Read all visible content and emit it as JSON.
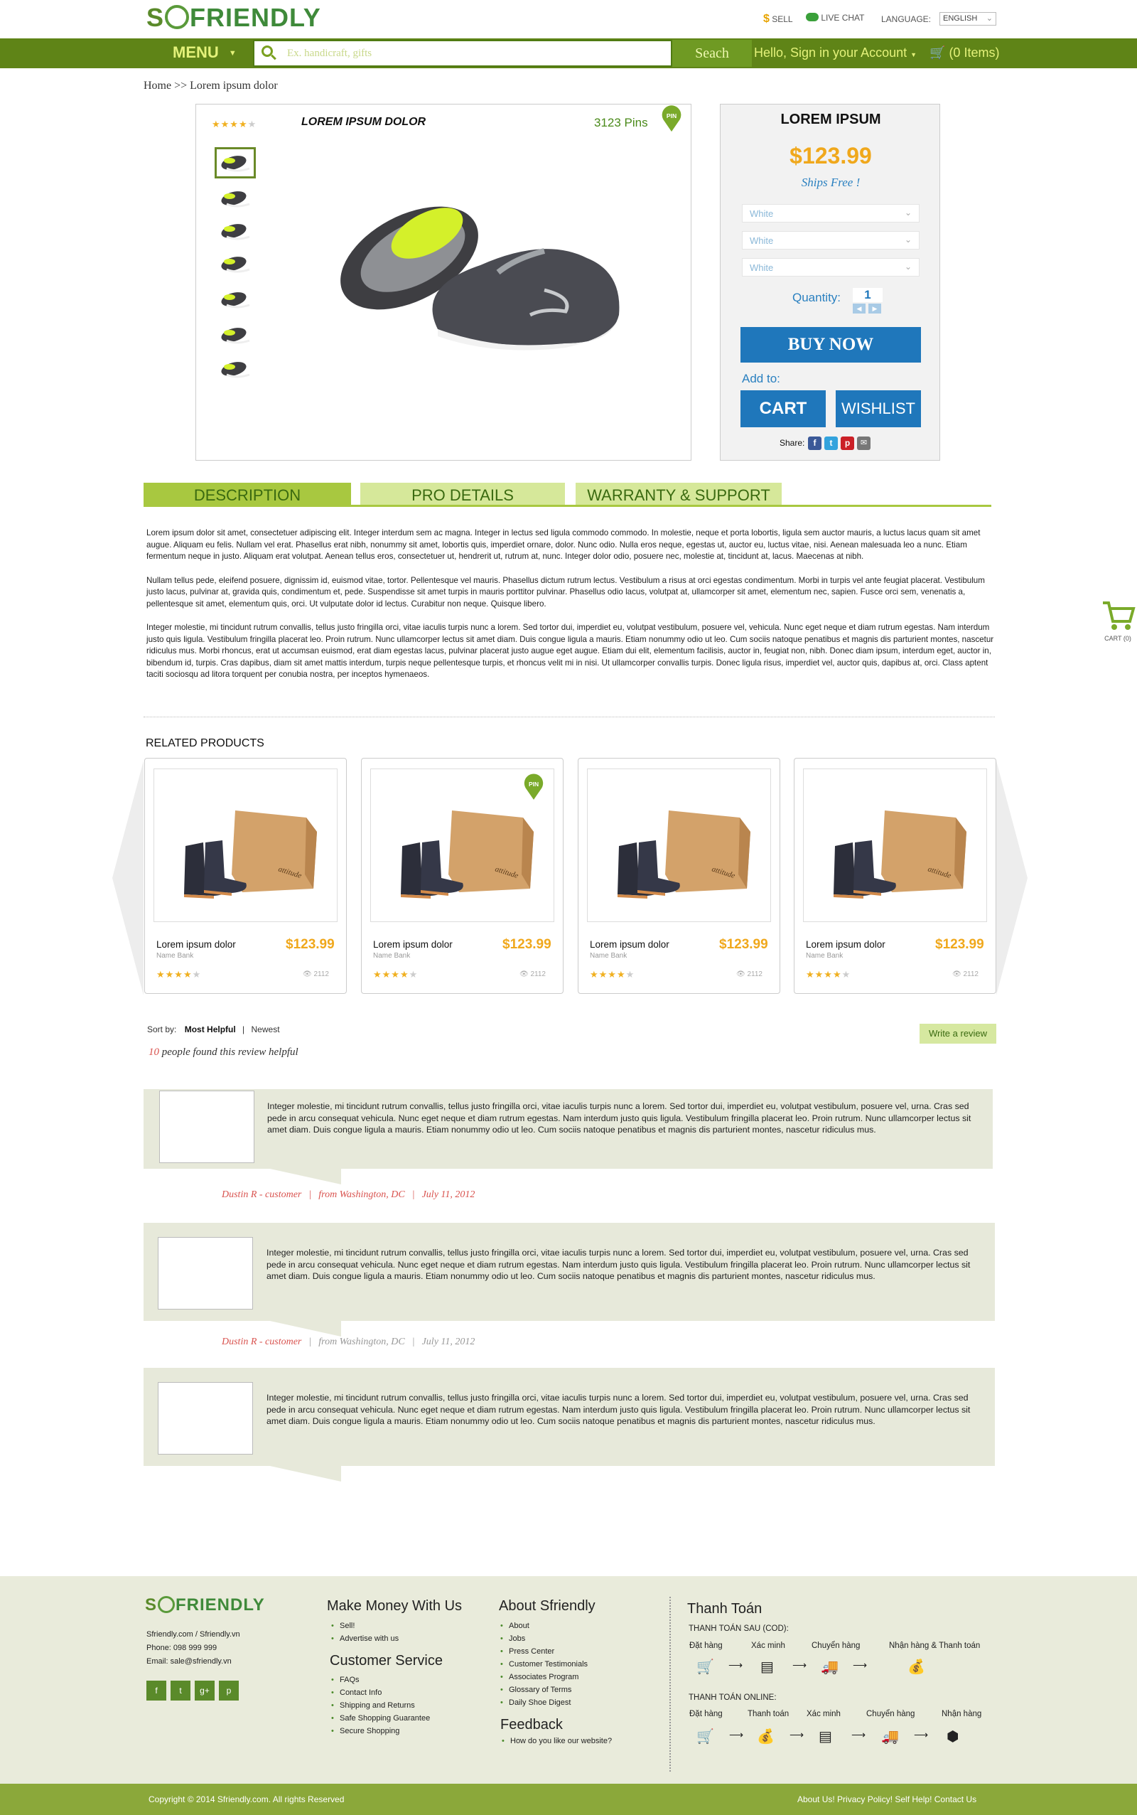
{
  "header": {
    "logo_prefix": "S",
    "logo_suffix": "FRIENDLY",
    "sell": "SELL",
    "live_chat": "LIVE CHAT",
    "language_label": "LANGUAGE:",
    "language_value": "ENGLISH",
    "menu": "MENU",
    "search_placeholder": "Ex. handicraft, gifts",
    "search_button": "Seach",
    "account": "Hello, Sign in your Account",
    "cart_items": "(0 Items)"
  },
  "breadcrumb": "Home >> Lorem ipsum dolor",
  "product": {
    "name": "LOREM IPSUM DOLOR",
    "pins": "3123 Pins",
    "pin_badge": "PIN",
    "rating": 4,
    "thumb_count": 7
  },
  "buy_panel": {
    "title": "LOREM IPSUM",
    "price": "$123.99",
    "shipping": "Ships Free !",
    "options": [
      "White",
      "White",
      "White"
    ],
    "quantity_label": "Quantity:",
    "quantity_value": "1",
    "buy_now": "BUY NOW",
    "add_to": "Add to:",
    "cart": "CART",
    "wishlist": "WISHLIST",
    "share": "Share:"
  },
  "tabs": [
    "DESCRIPTION",
    "PRO DETAILS",
    "WARRANTY & SUPPORT"
  ],
  "description": [
    "Lorem ipsum dolor sit amet, consectetuer adipiscing elit. Integer interdum sem ac magna. Integer in lectus sed ligula commodo commodo. In molestie, neque et porta lobortis, ligula sem auctor mauris, a luctus lacus quam sit amet augue. Aliquam eu felis. Nullam vel erat. Phasellus erat nibh, nonummy sit amet, lobortis quis, imperdiet ornare, dolor. Nunc odio. Nulla eros neque, egestas ut, auctor eu, luctus vitae, nisi. Aenean malesuada leo a nunc. Etiam fermentum neque in justo. Aliquam erat volutpat. Aenean tellus eros, consectetuer ut, hendrerit ut, rutrum at, nunc. Integer dolor odio, posuere nec, molestie at, tincidunt at, lacus. Maecenas at nibh.",
    "Nullam tellus pede, eleifend posuere, dignissim id, euismod vitae, tortor. Pellentesque vel mauris. Phasellus dictum rutrum lectus. Vestibulum a risus at orci egestas condimentum. Morbi in turpis vel ante feugiat placerat. Vestibulum justo lacus, pulvinar at, gravida quis, condimentum et, pede. Suspendisse sit amet turpis in mauris porttitor pulvinar. Phasellus odio lacus, volutpat at, ullamcorper sit amet, elementum nec, sapien. Fusce orci sem, venenatis a, pellentesque sit amet, elementum quis, orci. Ut vulputate dolor id lectus. Curabitur non neque. Quisque libero.",
    "Integer molestie, mi tincidunt rutrum convallis, tellus justo fringilla orci, vitae iaculis turpis nunc a lorem. Sed tortor dui, imperdiet eu, volutpat vestibulum, posuere vel, vehicula. Nunc eget neque et diam rutrum egestas. Nam interdum justo quis ligula. Vestibulum fringilla placerat leo. Proin rutrum. Nunc ullamcorper lectus sit amet diam. Duis congue ligula a mauris. Etiam nonummy odio ut leo. Cum sociis natoque penatibus et magnis dis parturient montes, nascetur ridiculus mus. Morbi rhoncus, erat ut accumsan euismod, erat diam egestas lacus, pulvinar placerat justo augue eget augue. Etiam dui elit, elementum facilisis, auctor in, feugiat non, nibh. Donec diam ipsum, interdum eget, auctor in, bibendum id, turpis. Cras dapibus, diam sit amet mattis interdum, turpis neque pellentesque turpis, et rhoncus velit mi in nisi. Ut ullamcorper convallis turpis. Donec ligula risus, imperdiet vel, auctor quis, dapibus at, orci. Class aptent taciti sociosqu ad litora torquent per conubia nostra, per inceptos hymenaeos."
  ],
  "side_cart": "CART (0)",
  "related": {
    "title": "RELATED PRODUCTS",
    "items": [
      {
        "name": "Lorem ipsum dolor",
        "brand": "Name Bank",
        "price": "$123.99",
        "views": "2112",
        "rating": 4,
        "pin": false
      },
      {
        "name": "Lorem ipsum dolor",
        "brand": "Name Bank",
        "price": "$123.99",
        "views": "2112",
        "rating": 4,
        "pin": true
      },
      {
        "name": "Lorem ipsum dolor",
        "brand": "Name Bank",
        "price": "$123.99",
        "views": "2112",
        "rating": 4,
        "pin": false
      },
      {
        "name": "Lorem ipsum dolor",
        "brand": "Name Bank",
        "price": "$123.99",
        "views": "2112",
        "rating": 4,
        "pin": false
      }
    ],
    "box_label": "attitude"
  },
  "reviews": {
    "sort_label": "Sort by:",
    "sort_most_helpful": "Most Helpful",
    "sort_sep": "|",
    "sort_newest": "Newest",
    "write_review": "Write a review",
    "helpful_count": "10",
    "helpful_text": "people found this review helpful",
    "items": [
      {
        "text": "Integer molestie, mi tincidunt rutrum convallis, tellus justo fringilla orci, vitae iaculis turpis nunc a lorem. Sed tortor dui, imperdiet eu, volutpat vestibulum, posuere vel, urna. Cras sed pede in arcu consequat vehicula. Nunc eget neque et diam rutrum egestas. Nam interdum justo quis ligula. Vestibulum fringilla placerat leo. Proin rutrum. Nunc ullamcorper lectus sit amet diam. Duis congue ligula a mauris. Etiam nonummy odio ut leo. Cum sociis natoque penatibus et magnis dis parturient montes, nascetur ridiculus mus.",
        "author": "Dustin R - customer",
        "location": "from Washington, DC",
        "date": "July 11, 2012"
      },
      {
        "text": "Integer molestie, mi tincidunt rutrum convallis, tellus justo fringilla orci, vitae iaculis turpis nunc a lorem. Sed tortor dui, imperdiet eu, volutpat vestibulum, posuere vel, urna. Cras sed pede in arcu consequat vehicula. Nunc eget neque et diam rutrum egestas. Nam interdum justo quis ligula. Vestibulum fringilla placerat leo. Proin rutrum. Nunc ullamcorper lectus sit amet diam. Duis congue ligula a mauris. Etiam nonummy odio ut leo. Cum sociis natoque penatibus et magnis dis parturient montes, nascetur ridiculus mus.",
        "author": "Dustin R - customer",
        "location": "from Washington, DC",
        "date": "July 11, 2012"
      },
      {
        "text": "Integer molestie, mi tincidunt rutrum convallis, tellus justo fringilla orci, vitae iaculis turpis nunc a lorem. Sed tortor dui, imperdiet eu, volutpat vestibulum, posuere vel, urna. Cras sed pede in arcu consequat vehicula. Nunc eget neque et diam rutrum egestas. Nam interdum justo quis ligula. Vestibulum fringilla placerat leo. Proin rutrum. Nunc ullamcorper lectus sit amet diam. Duis congue ligula a mauris. Etiam nonummy odio ut leo. Cum sociis natoque penatibus et magnis dis parturient montes, nascetur ridiculus mus.",
        "author": "",
        "location": "",
        "date": ""
      }
    ]
  },
  "footer": {
    "contact": [
      "Sfriendly.com /  Sfriendly.vn",
      "Phone: 098 999 999",
      "Email: sale@sfriendly.vn"
    ],
    "social": [
      "f",
      "t",
      "g+",
      "p"
    ],
    "make_money_title": "Make Money With Us",
    "make_money": [
      "Sell!",
      "Advertise with us"
    ],
    "customer_service_title": "Customer Service",
    "customer_service": [
      "FAQs",
      "Contact Info",
      "Shipping and Returns",
      "Safe Shopping Guarantee",
      "Secure Shopping"
    ],
    "about_title": "About Sfriendly",
    "about": [
      "About",
      "Jobs",
      "Press Center",
      "Customer Testimonials",
      "Associates Program",
      "Glossary of Terms",
      "Daily Shoe Digest"
    ],
    "feedback_title": "Feedback",
    "feedback": [
      "How do you like our website?"
    ],
    "payment_title": "Thanh Toán",
    "cod_title": "THANH TOÁN SAU (COD):",
    "cod_steps": [
      "Đặt hàng",
      "Xác minh",
      "Chuyển hàng",
      "Nhận hàng & Thanh toán"
    ],
    "online_title": "THANH TOÁN ONLINE:",
    "online_steps": [
      "Đặt hàng",
      "Thanh toán",
      "Xác minh",
      "Chuyển hàng",
      "Nhận hàng"
    ],
    "copyright": "Copyright © 2014 Sfriendly.com. All rights Reserved",
    "bottom_links": "About Us! Privacy Policy! Self Help! Contact Us"
  },
  "colors": {
    "nav_green": "#5f8417",
    "accent_yellow": "#e4f27a",
    "price_orange": "#f0a81c",
    "button_blue": "#1f77bb",
    "tab_green": "#c6dc74",
    "review_bg": "#e7e9da",
    "review_author": "#d9534f"
  }
}
